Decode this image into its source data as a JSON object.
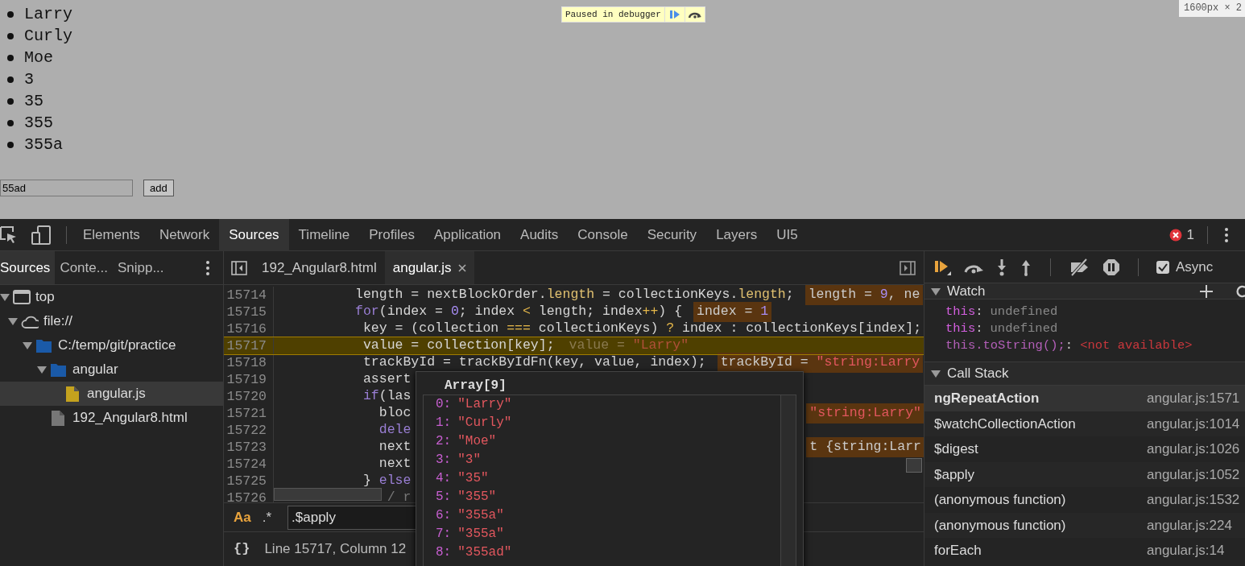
{
  "page": {
    "list_items": [
      "Larry",
      "Curly",
      "Moe",
      "3",
      "35",
      "355",
      "355a"
    ],
    "input": {
      "value": "55ad"
    },
    "add_button": "add",
    "paused_overlay": {
      "label": "Paused in debugger"
    },
    "size_badge": "1600px × 2"
  },
  "devtools": {
    "tabs": [
      {
        "label": "Elements",
        "selected": false
      },
      {
        "label": "Network",
        "selected": false
      },
      {
        "label": "Sources",
        "selected": true
      },
      {
        "label": "Timeline",
        "selected": false
      },
      {
        "label": "Profiles",
        "selected": false
      },
      {
        "label": "Application",
        "selected": false
      },
      {
        "label": "Audits",
        "selected": false
      },
      {
        "label": "Console",
        "selected": false
      },
      {
        "label": "Security",
        "selected": false
      },
      {
        "label": "Layers",
        "selected": false
      },
      {
        "label": "UI5",
        "selected": false
      }
    ],
    "error_count": "1",
    "navigator": {
      "tabs": [
        {
          "label": "Sources",
          "selected": true
        },
        {
          "label": "Conte...",
          "selected": false
        },
        {
          "label": "Snipp...",
          "selected": false
        }
      ],
      "tree": [
        {
          "label": "top",
          "kind": "window",
          "expanded": true,
          "selected": false,
          "children": [
            {
              "label": "file://",
              "kind": "cloud",
              "expanded": true,
              "selected": false,
              "children": [
                {
                  "label": "C:/temp/git/practice",
                  "kind": "folder",
                  "expanded": true,
                  "selected": false,
                  "children": [
                    {
                      "label": "angular",
                      "kind": "folder",
                      "expanded": true,
                      "selected": false,
                      "children": [
                        {
                          "label": "angular.js",
                          "kind": "script",
                          "selected": true
                        }
                      ]
                    },
                    {
                      "label": "192_Angular8.html",
                      "kind": "file",
                      "selected": false
                    }
                  ]
                }
              ]
            }
          ]
        }
      ]
    },
    "editor": {
      "tabs": [
        {
          "label": "192_Angular8.html",
          "selected": false,
          "closable": false
        },
        {
          "label": "angular.js",
          "selected": true,
          "closable": true
        }
      ],
      "lines": [
        {
          "number": "15714",
          "current": false,
          "segments": [
            {
              "text": "          length = nextBlockOrder.",
              "kind": "plain"
            },
            {
              "text": "length",
              "kind": "prop"
            },
            {
              "text": " = collectionKeys.",
              "kind": "plain"
            },
            {
              "text": "length",
              "kind": "prop"
            },
            {
              "text": ";",
              "kind": "plain"
            }
          ],
          "annotation": [
            {
              "text": "length = ",
              "kind": "plain"
            },
            {
              "text": "9",
              "kind": "number"
            },
            {
              "text": ", ne",
              "kind": "plain"
            }
          ]
        },
        {
          "number": "15715",
          "current": false,
          "segments": [
            {
              "text": "          for",
              "kind": "keyword"
            },
            {
              "text": "(index = ",
              "kind": "plain"
            },
            {
              "text": "0",
              "kind": "number"
            },
            {
              "text": "; index ",
              "kind": "plain"
            },
            {
              "text": "<",
              "kind": "op"
            },
            {
              "text": " length; index",
              "kind": "plain"
            },
            {
              "text": "++",
              "kind": "op"
            },
            {
              "text": ") {",
              "kind": "plain"
            }
          ],
          "annotation": [
            {
              "text": "index = ",
              "kind": "plain"
            },
            {
              "text": "1",
              "kind": "number"
            }
          ]
        },
        {
          "number": "15716",
          "current": false,
          "segments": [
            {
              "text": "           key = (collection ",
              "kind": "plain"
            },
            {
              "text": "===",
              "kind": "op"
            },
            {
              "text": " collectionKeys) ",
              "kind": "plain"
            },
            {
              "text": "?",
              "kind": "op"
            },
            {
              "text": " index : collectionKeys[index];",
              "kind": "plain"
            }
          ]
        },
        {
          "number": "15717",
          "current": true,
          "segments": [
            {
              "text": "           value = collection[key];",
              "kind": "plain"
            }
          ],
          "annotation": [
            {
              "text": "value = ",
              "kind": "plain"
            },
            {
              "text": "\"Larry\"",
              "kind": "string"
            }
          ]
        },
        {
          "number": "15718",
          "current": false,
          "segments": [
            {
              "text": "           trackById = trackByIdFn(key, value, index);",
              "kind": "plain"
            }
          ],
          "annotation": [
            {
              "text": "trackById = ",
              "kind": "plain"
            },
            {
              "text": "\"string:Larry",
              "kind": "string"
            }
          ]
        },
        {
          "number": "15719",
          "current": false,
          "segments": [
            {
              "text": "           assert",
              "kind": "plain"
            }
          ]
        },
        {
          "number": "15720",
          "current": false,
          "segments": [
            {
              "text": "           if",
              "kind": "keyword"
            },
            {
              "text": "(las",
              "kind": "plain"
            }
          ]
        },
        {
          "number": "15721",
          "current": false,
          "segments": [
            {
              "text": "             bloc",
              "kind": "plain"
            }
          ],
          "annotation": [
            {
              "text": "\"string:Larry\"",
              "kind": "string"
            }
          ]
        },
        {
          "number": "15722",
          "current": false,
          "segments": [
            {
              "text": "             dele",
              "kind": "keyword"
            }
          ]
        },
        {
          "number": "15723",
          "current": false,
          "segments": [
            {
              "text": "             next",
              "kind": "plain"
            }
          ],
          "annotation": [
            {
              "text": "t {string:Larr",
              "kind": "plain"
            }
          ]
        },
        {
          "number": "15724",
          "current": false,
          "segments": [
            {
              "text": "             next",
              "kind": "plain"
            }
          ]
        },
        {
          "number": "15725",
          "current": false,
          "segments": [
            {
              "text": "           } ",
              "kind": "plain"
            },
            {
              "text": "else",
              "kind": "keyword"
            }
          ]
        },
        {
          "number": "15726",
          "current": false,
          "segments": [
            {
              "text": "              / r",
              "kind": "comment"
            }
          ]
        }
      ],
      "popup": {
        "title": "Array[9]",
        "items": [
          {
            "index": "0:",
            "value": "\"Larry\""
          },
          {
            "index": "1:",
            "value": "\"Curly\""
          },
          {
            "index": "2:",
            "value": "\"Moe\""
          },
          {
            "index": "3:",
            "value": "\"3\""
          },
          {
            "index": "4:",
            "value": "\"35\""
          },
          {
            "index": "5:",
            "value": "\"355\""
          },
          {
            "index": "6:",
            "value": "\"355a\""
          },
          {
            "index": "7:",
            "value": "\"355a\""
          },
          {
            "index": "8:",
            "value": "\"355ad\""
          }
        ]
      },
      "search": {
        "case_toggle": "Aa",
        "regex_toggle": ".*",
        "value": ".$apply"
      },
      "status": {
        "braces": "{}",
        "position": "Line 15717, Column 12"
      }
    },
    "debugger": {
      "async": {
        "label": "Async",
        "checked": true
      },
      "watch": {
        "title": "Watch",
        "expanded": true,
        "items": [
          {
            "name": "this",
            "separator": ":",
            "value": "undefined",
            "kind": "value"
          },
          {
            "name": "this",
            "separator": ":",
            "value": "undefined",
            "kind": "value"
          },
          {
            "name": "this.toString();",
            "separator": ":",
            "value": "<not available>",
            "kind": "error"
          }
        ]
      },
      "call_stack": {
        "title": "Call Stack",
        "expanded": true,
        "frames": [
          {
            "function": "ngRepeatAction",
            "location": "angular.js:1571",
            "selected": true
          },
          {
            "function": "$watchCollectionAction",
            "location": "angular.js:1014",
            "selected": false
          },
          {
            "function": "$digest",
            "location": "angular.js:1026",
            "selected": false
          },
          {
            "function": "$apply",
            "location": "angular.js:1052",
            "selected": false
          },
          {
            "function": "(anonymous function)",
            "location": "angular.js:1532",
            "selected": false
          },
          {
            "function": "(anonymous function)",
            "location": "angular.js:224",
            "selected": false
          },
          {
            "function": "forEach",
            "location": "angular.js:14",
            "selected": false
          }
        ]
      }
    }
  }
}
